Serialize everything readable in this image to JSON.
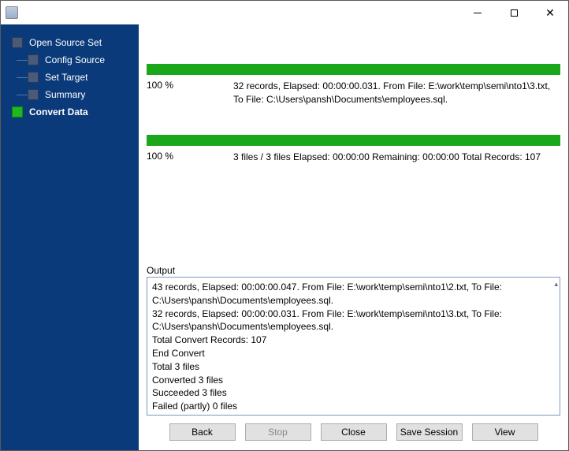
{
  "titlebar": {
    "title": ""
  },
  "sidebar": {
    "items": [
      {
        "label": "Open Source Set",
        "active": false,
        "level": "root"
      },
      {
        "label": "Config Source",
        "active": false,
        "level": "child"
      },
      {
        "label": "Set Target",
        "active": false,
        "level": "child"
      },
      {
        "label": "Summary",
        "active": false,
        "level": "child"
      },
      {
        "label": "Convert Data",
        "active": true,
        "level": "root"
      }
    ]
  },
  "progress1": {
    "percent_text": "100 %",
    "details": "32 records,   Elapsed: 00:00:00.031.   From File: E:\\work\\temp\\semi\\nto1\\3.txt,   To File: C:\\Users\\pansh\\Documents\\employees.sql."
  },
  "progress2": {
    "percent_text": "100 %",
    "details": "3 files / 3 files   Elapsed: 00:00:00   Remaining: 00:00:00   Total Records: 107"
  },
  "output": {
    "label": "Output",
    "lines": [
      "43 records,   Elapsed: 00:00:00.047.   From File: E:\\work\\temp\\semi\\nto1\\2.txt,   To File: C:\\Users\\pansh\\Documents\\employees.sql.",
      "32 records,   Elapsed: 00:00:00.031.   From File: E:\\work\\temp\\semi\\nto1\\3.txt,   To File: C:\\Users\\pansh\\Documents\\employees.sql.",
      "Total Convert Records: 107",
      "End Convert",
      "Total 3 files",
      "Converted 3 files",
      "Succeeded 3 files",
      "Failed (partly) 0 files"
    ]
  },
  "buttons": {
    "back": "Back",
    "stop": "Stop",
    "close": "Close",
    "save_session": "Save Session",
    "view": "View"
  }
}
